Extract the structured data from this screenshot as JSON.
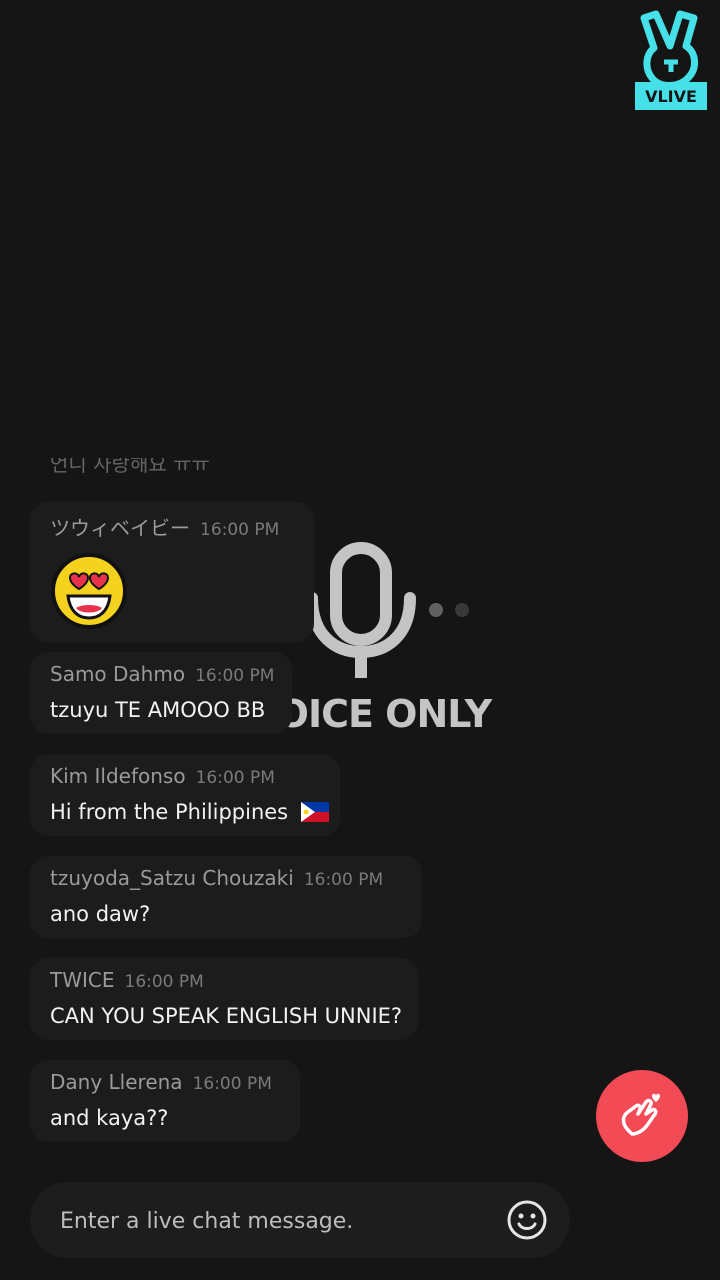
{
  "logo": {
    "text": "VLIVE",
    "color": "#45e0e8"
  },
  "overlay": {
    "label": "VOICE ONLY",
    "icon": "microphone-icon"
  },
  "chat": {
    "faded_text": "언니 사랑해요 ㅠㅠ",
    "messages": [
      {
        "author": "ツウィベイビー",
        "time": "16:00 PM",
        "text": "",
        "emoji": "heart-eyes-emoji"
      },
      {
        "author": "Samo Dahmo",
        "time": "16:00 PM",
        "text": "tzuyu TE AMOOO BB"
      },
      {
        "author": "Kim Ildefonso",
        "time": "16:00 PM",
        "text": "Hi from the Philippines",
        "flag": "philippines-flag"
      },
      {
        "author": "tzuyoda_Satzu Chouzaki",
        "time": "16:00 PM",
        "text": "ano daw?"
      },
      {
        "author": "TWICE",
        "time": "16:00 PM",
        "text": "CAN YOU SPEAK ENGLISH UNNIE?"
      },
      {
        "author": "Dany Llerena",
        "time": "16:00 PM",
        "text": "and kaya??"
      }
    ]
  },
  "input": {
    "placeholder": "Enter a live chat message."
  },
  "colors": {
    "background": "#151515",
    "heart_button": "#f24b55",
    "bubble": "#1c1c1c"
  }
}
